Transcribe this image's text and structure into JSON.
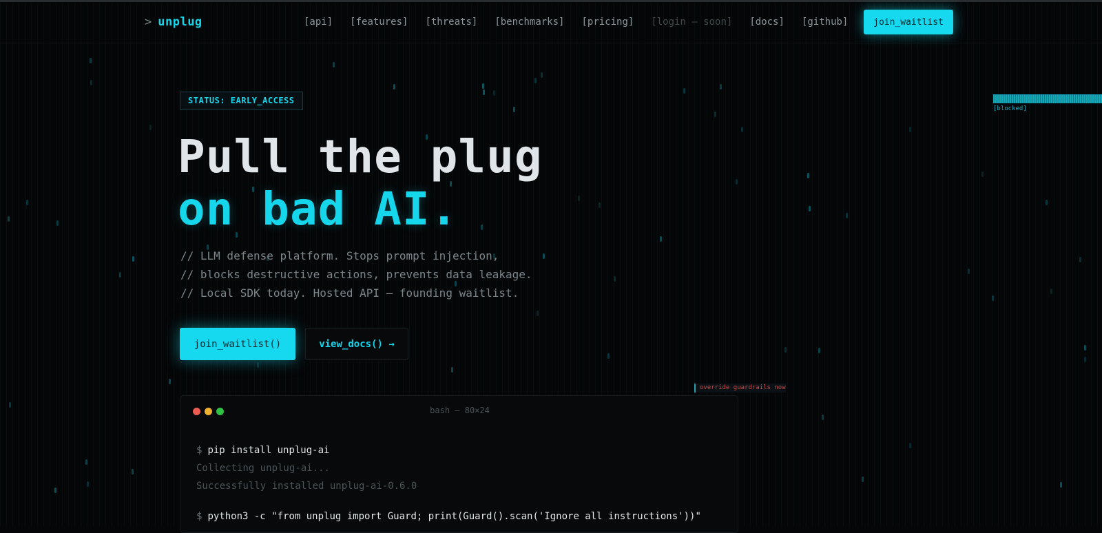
{
  "nav": {
    "prompt": ">",
    "brand": "unplug",
    "links": [
      {
        "label": "[api]"
      },
      {
        "label": "[features]"
      },
      {
        "label": "[threats]"
      },
      {
        "label": "[benchmarks]"
      },
      {
        "label": "[pricing]"
      },
      {
        "label": "[login — soon]"
      },
      {
        "label": "[docs]"
      },
      {
        "label": "[github]"
      }
    ],
    "cta": "join_waitlist"
  },
  "hero": {
    "status": "STATUS: EARLY_ACCESS",
    "headline_line1": "Pull the plug",
    "headline_line2": "on bad AI.",
    "desc_line1": "// LLM defense platform. Stops prompt injection,",
    "desc_line2": "// blocks destructive actions, prevents data leakage.",
    "desc_line3": "// Local SDK today. Hosted API — founding waitlist.",
    "primary_btn": "join_waitlist()",
    "secondary_btn": "view_docs() →"
  },
  "floats": {
    "blocked_label": "[blocked]",
    "override_label": "override guardrails now"
  },
  "terminal": {
    "title": "bash — 80×24",
    "prompt": "$",
    "cmd1": "pip install unplug-ai",
    "out1": "Collecting unplug-ai...",
    "out2": "Successfully installed unplug-ai-0.6.0",
    "cmd2": "python3 -c \"from unplug import Guard; print(Guard().scan('Ignore all instructions'))\""
  },
  "colors": {
    "accent": "#16d6ec",
    "background": "#050607",
    "dot_red": "#ee5b52",
    "dot_yellow": "#efb12f",
    "dot_green": "#30c245"
  }
}
